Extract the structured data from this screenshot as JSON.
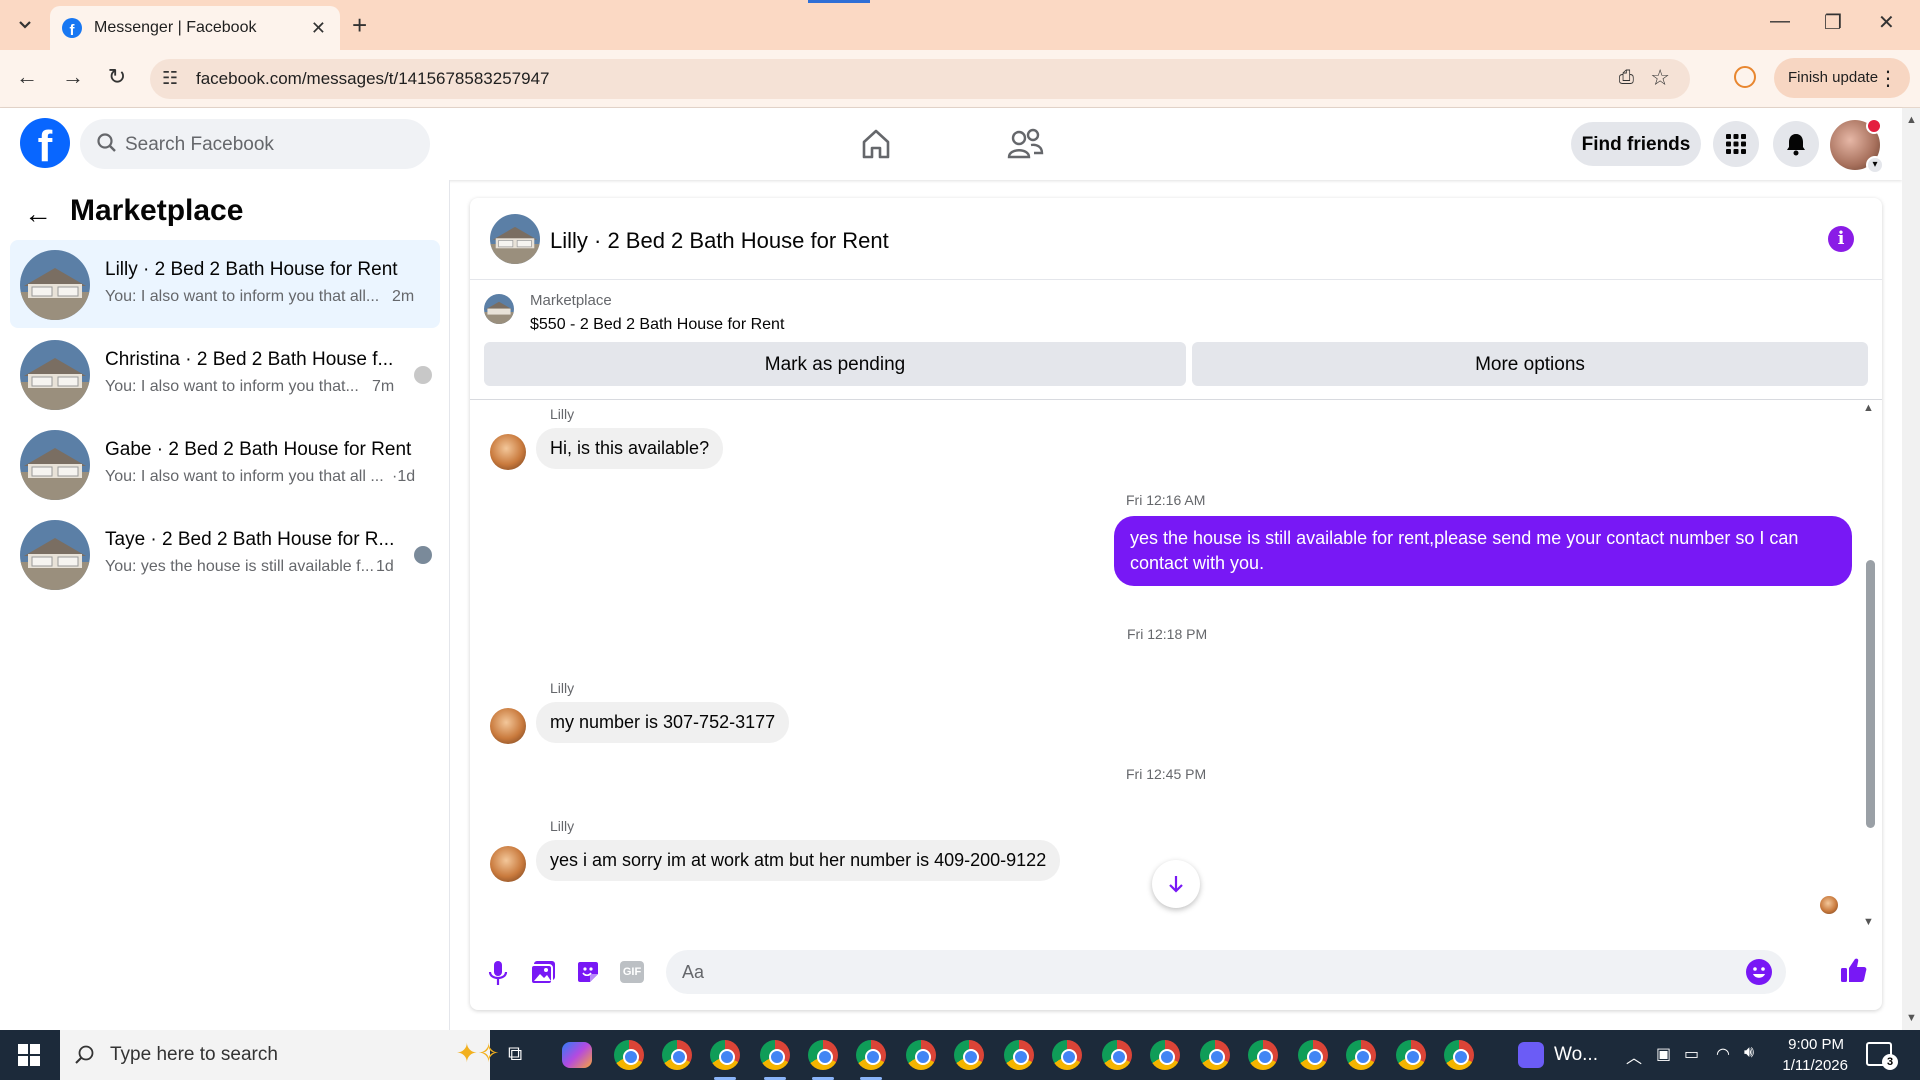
{
  "browser": {
    "tab_title": "Messenger | Facebook",
    "url": "facebook.com/messages/t/1415678583257947",
    "finish_update": "Finish update"
  },
  "fb_header": {
    "search_placeholder": "Search Facebook",
    "find_friends": "Find friends",
    "notification_dot_color": "#e41e3f"
  },
  "sidebar": {
    "title": "Marketplace",
    "conversations": [
      {
        "name": "Lilly · 2 Bed 2 Bath House for Rent",
        "preview": "You: I also want to inform you that all...",
        "time": "2m",
        "active": true
      },
      {
        "name": "Christina · 2 Bed 2 Bath House f...",
        "preview": "You: I also want to inform you that...",
        "time": "7m",
        "active": false
      },
      {
        "name": "Gabe · 2 Bed 2 Bath House for Rent",
        "preview": "You: I also want to inform you that all ...",
        "time": "·1d",
        "active": false
      },
      {
        "name": "Taye · 2 Bed 2 Bath House for R...",
        "preview": "You: yes the house is still available f...",
        "time": "1d",
        "active": false
      }
    ]
  },
  "chat": {
    "title": "Lilly · 2 Bed 2 Bath House for Rent",
    "listing_label": "Marketplace",
    "listing_price": "$550 - 2 Bed 2 Bath House for Rent",
    "mark_pending": "Mark as pending",
    "more_options": "More options",
    "accent_color": "#7818f5",
    "messages": [
      {
        "sender": "Lilly",
        "text": "Hi, is this available?"
      },
      {
        "stamp": "Fri 12:16 AM"
      },
      {
        "outgoing_line1": "yes the house is still available for rent,please send me your contact number so I can",
        "outgoing_line2": "contact with you."
      },
      {
        "stamp": "Fri 12:18 PM"
      },
      {
        "sender": "Lilly",
        "text": "my number is 307-752-3177"
      },
      {
        "stamp": "Fri 12:45 PM"
      },
      {
        "sender": "Lilly",
        "text": "yes i am sorry im at work atm but her number is 409-200-9122"
      }
    ],
    "composer_placeholder": "Aa",
    "composer_icons": [
      "microphone-icon",
      "photo-icon",
      "sticker-icon",
      "gif-icon",
      "emoji-icon",
      "thumbs-up-icon"
    ]
  },
  "taskbar": {
    "search_placeholder": "Type here to search",
    "zoom_label": "Wo...",
    "time": "9:00 PM",
    "date": "1/11/2026",
    "notification_count": "3"
  }
}
